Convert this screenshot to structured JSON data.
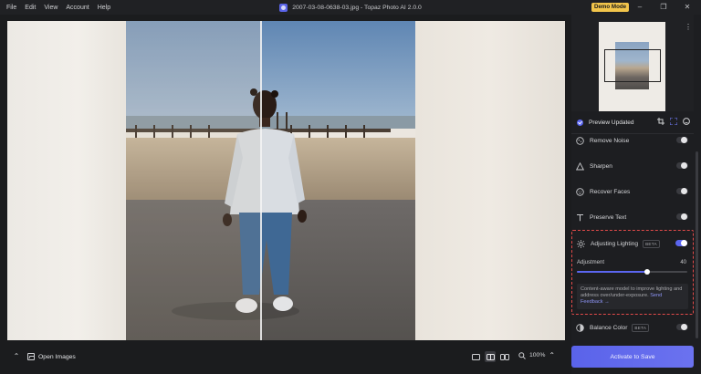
{
  "menu": [
    "File",
    "Edit",
    "View",
    "Account",
    "Help"
  ],
  "window": {
    "title": "2007-03-08-0638-03.jpg - Topaz Photo AI 2.0.0",
    "demo_badge": "Demo Mode"
  },
  "bottom_bar": {
    "open_images": "Open Images",
    "zoom": "100%"
  },
  "panel": {
    "preview_status": "Preview Updated",
    "filters": [
      {
        "label": "Remove Noise",
        "enabled": false
      },
      {
        "label": "Sharpen",
        "enabled": false
      },
      {
        "label": "Recover Faces",
        "enabled": false
      },
      {
        "label": "Preserve Text",
        "enabled": false
      }
    ],
    "active_filter": {
      "label": "Adjusting Lighting",
      "badge": "BETA",
      "enabled": true,
      "adjustment_label": "Adjustment",
      "adjustment_value": "40",
      "adjustment_fraction": 0.64,
      "description": "Content-aware model to improve lighting and address over/under-exposure.",
      "feedback_link": "Send Feedback →"
    },
    "balance_color": {
      "label": "Balance Color",
      "badge": "BETA",
      "enabled": false
    },
    "activate_button": "Activate to Save"
  },
  "colors": {
    "accent": "#5b66f0",
    "demo_badge": "#f2c54b",
    "highlight_border": "#e24a4a"
  }
}
